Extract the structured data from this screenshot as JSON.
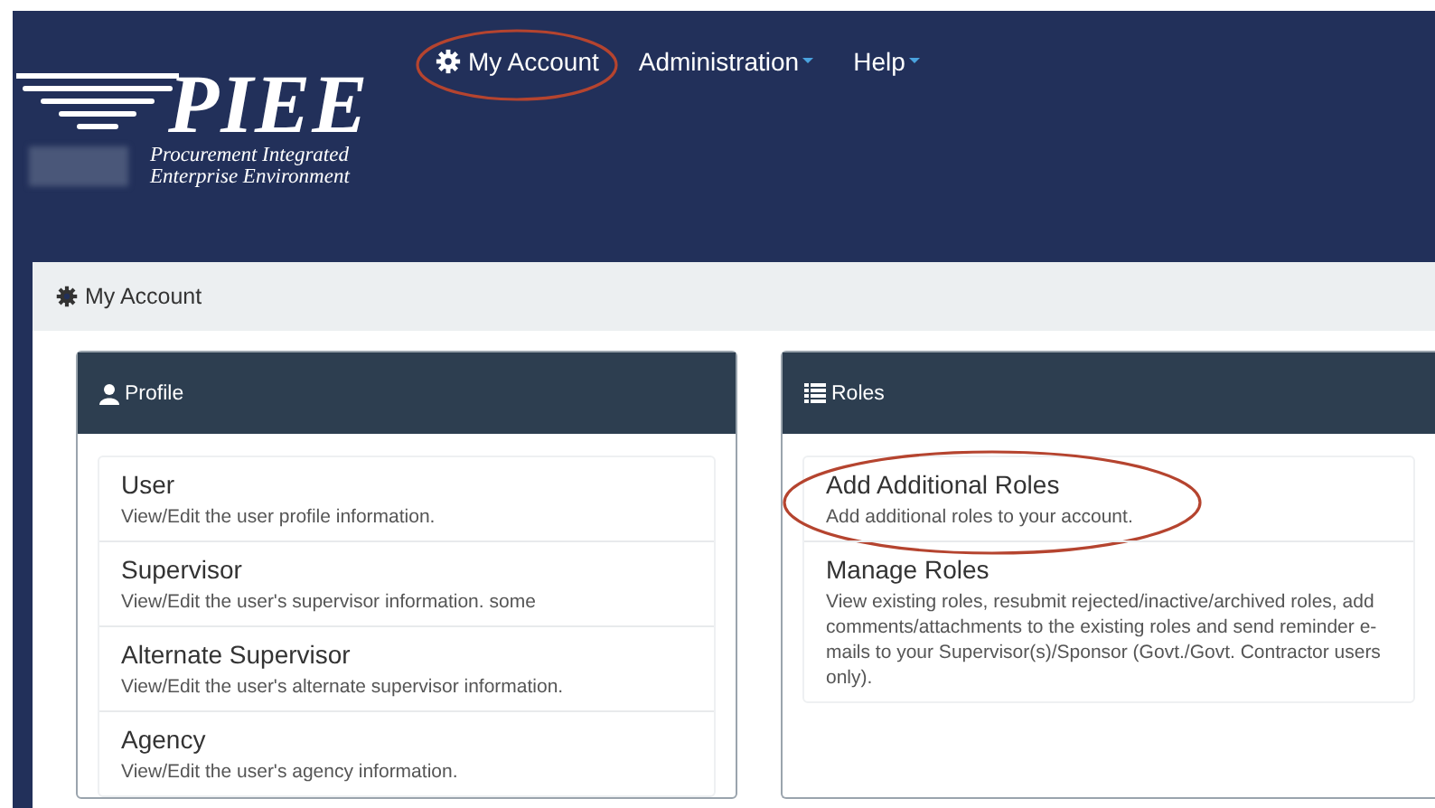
{
  "header": {
    "logo": {
      "title": "PIEE",
      "tagline": [
        "Procurement Integrated",
        "Enterprise Environment"
      ]
    },
    "nav": [
      {
        "label": "My Account",
        "dropdown": false,
        "circled": true
      },
      {
        "label": "Administration",
        "dropdown": true,
        "circled": false
      },
      {
        "label": "Help",
        "dropdown": true,
        "circled": false
      }
    ]
  },
  "page_header": {
    "title": "My Account"
  },
  "panels": [
    {
      "title": "Profile",
      "items": [
        {
          "title": "User",
          "description": "View/Edit the user profile information.",
          "circled": false
        },
        {
          "title": "Supervisor",
          "description": "View/Edit the user's supervisor information. some",
          "circled": false
        },
        {
          "title": "Alternate Supervisor",
          "description": "View/Edit the user's alternate supervisor information.",
          "circled": false
        },
        {
          "title": "Agency",
          "description": "View/Edit the user's agency information.",
          "circled": false
        }
      ]
    },
    {
      "title": "Roles",
      "items": [
        {
          "title": "Add Additional Roles",
          "description": "Add additional roles to your account.",
          "circled": true
        },
        {
          "title": "Manage Roles",
          "description": "View existing roles, resubmit rejected/inactive/archived roles, add comments/attachments to the existing roles and send reminder e-mails to your Supervisor(s)/Sponsor (Govt./Govt. Contractor users only).",
          "circled": false
        }
      ]
    }
  ]
}
